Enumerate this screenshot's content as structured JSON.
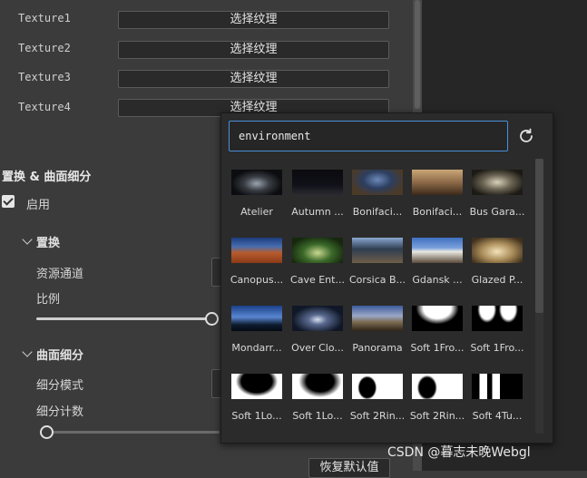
{
  "textures": [
    {
      "label": "Texture1",
      "button": "选择纹理"
    },
    {
      "label": "Texture2",
      "button": "选择纹理"
    },
    {
      "label": "Texture3",
      "button": "选择纹理"
    },
    {
      "label": "Texture4",
      "button": "选择纹理"
    }
  ],
  "displacement_section": {
    "title": "置换 & 曲面细分",
    "enable_label": "启用",
    "enabled": true,
    "displacement": {
      "title": "置换",
      "resource_channel_label": "资源通道",
      "scale_label": "比例",
      "scale_value": 1.0
    },
    "tessellation": {
      "title": "曲面细分",
      "mode_label": "细分模式",
      "count_label": "细分计数",
      "count_value": 0.0
    },
    "reset_label": "恢复默认值"
  },
  "popup": {
    "search_value": "environment",
    "icons": {
      "refresh": "refresh-icon"
    },
    "items": [
      {
        "label": "Atelier",
        "thumb": "atelier"
      },
      {
        "label": "Autumn ...",
        "thumb": "autumn"
      },
      {
        "label": "Bonifaci...",
        "thumb": "bonifacio1"
      },
      {
        "label": "Bonifaci...",
        "thumb": "bonifacio2"
      },
      {
        "label": "Bus Gara...",
        "thumb": "busgarage"
      },
      {
        "label": "Canopus...",
        "thumb": "canopus"
      },
      {
        "label": "Cave Ent...",
        "thumb": "cave"
      },
      {
        "label": "Corsica B...",
        "thumb": "corsica"
      },
      {
        "label": "Gdansk ...",
        "thumb": "gdansk"
      },
      {
        "label": "Glazed P...",
        "thumb": "glazed"
      },
      {
        "label": "Mondarr...",
        "thumb": "mondarr"
      },
      {
        "label": "Over Clo...",
        "thumb": "overclouds"
      },
      {
        "label": "Panorama",
        "thumb": "panorama"
      },
      {
        "label": "Soft 1Fro...",
        "thumb": "soft1front1"
      },
      {
        "label": "Soft 1Fro...",
        "thumb": "soft1front2"
      },
      {
        "label": "Soft 1Lo...",
        "thumb": "soft1lo1"
      },
      {
        "label": "Soft 1Lo...",
        "thumb": "soft1lo2"
      },
      {
        "label": "Soft 2Rin...",
        "thumb": "soft2rin1"
      },
      {
        "label": "Soft 2Rin...",
        "thumb": "soft2rin2"
      },
      {
        "label": "Soft 4Tu...",
        "thumb": "soft4tu"
      }
    ]
  },
  "watermark": "CSDN @暮志未晚Webgl"
}
